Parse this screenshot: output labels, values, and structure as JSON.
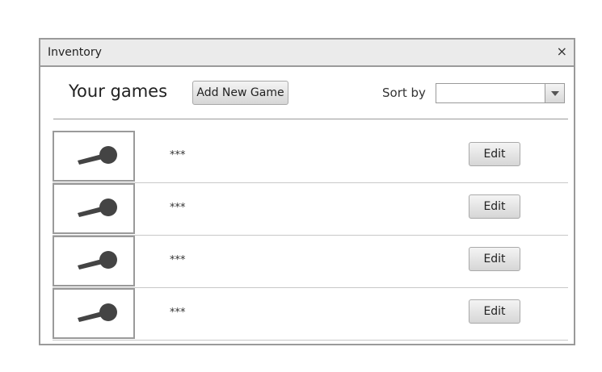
{
  "window": {
    "title": "Inventory",
    "close_glyph": "×"
  },
  "toolbar": {
    "heading": "Your games",
    "add_label": "Add New Game",
    "sort_label": "Sort by",
    "sort_value": ""
  },
  "games": [
    {
      "name": "***",
      "edit_label": "Edit",
      "thumbnail_icon": "game-controller-icon"
    },
    {
      "name": "***",
      "edit_label": "Edit",
      "thumbnail_icon": "game-controller-icon"
    },
    {
      "name": "***",
      "edit_label": "Edit",
      "thumbnail_icon": "game-controller-icon"
    },
    {
      "name": "***",
      "edit_label": "Edit",
      "thumbnail_icon": "game-controller-icon"
    }
  ],
  "colors": {
    "border": "#9a9a9a",
    "titlebar": "#ebebeb",
    "button": "#dedede",
    "icon": "#444444"
  }
}
